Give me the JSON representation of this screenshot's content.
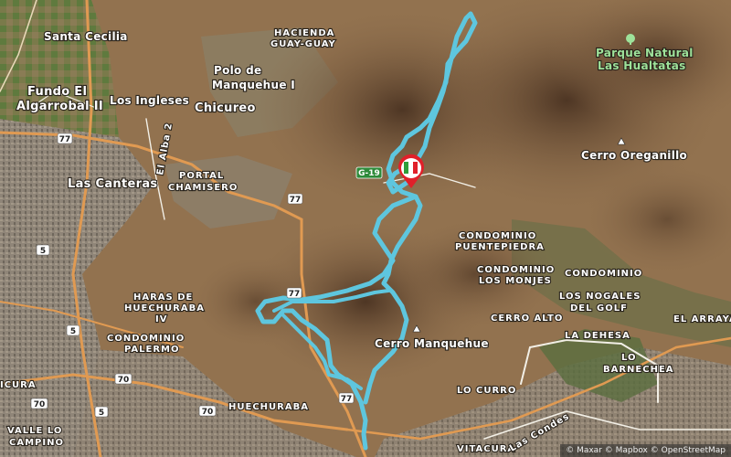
{
  "route_color": "#5ec6de",
  "labels": {
    "santa_cecilia": "Santa Cecilia",
    "fundo_el": "Fundo El",
    "algarrobal_ii": "Algarrobal II",
    "los_ingleses": "Los Ingleses",
    "chicureo": "Chicureo",
    "polo_de": "Polo de",
    "manquehue_i": "Manquehue I",
    "hacienda": "HACIENDA",
    "guay_guay": "GUAY-GUAY",
    "el_alba_2": "El Alba 2",
    "las_canteras": "Las Canteras",
    "portal": "PORTAL",
    "chamisero": "CHAMISERO",
    "parque_natural": "Parque Natural",
    "las_hualtatas": "Las Hualtatas",
    "cerro_oreganillo": "Cerro Oreganillo",
    "condominio_1": "CONDOMINIO",
    "puentepiedra": "PUENTEPIEDRA",
    "condominio_2": "CONDOMINIO",
    "los_monjes": "LOS MONJES",
    "condominio_3": "CONDOMINIO",
    "los_nogales": "LOS NOGALES",
    "del_golf": "DEL GOLF",
    "cerro_alto": "CERRO ALTO",
    "el_arrayan": "EL ARRAYÁN",
    "la_dehesa": "LA DEHESA",
    "lo_barnechea_1": "LO",
    "lo_barnechea_2": "BARNECHEA",
    "haras_de": "HARAS DE",
    "huechuraba_iv_1": "HUECHURABA",
    "huechuraba_iv_2": "IV",
    "condominio_4": "CONDOMINIO",
    "palermo": "PALERMO",
    "cerro_manquehue": "Cerro Manquehue",
    "lo_curro": "LO CURRO",
    "huechuraba": "HUECHURABA",
    "vitacura": "VITACURA",
    "las_condes": "Las Condes",
    "icura": "ICURA",
    "valle_lo": "VALLE LO",
    "campino": "CAMPINO"
  },
  "shields": {
    "r77a": "77",
    "r77b": "77",
    "r77c": "77",
    "r77d": "77",
    "r5a": "5",
    "r5b": "5",
    "r5c": "5",
    "r70a": "70",
    "r70b": "70",
    "r70c": "70",
    "g19": "G-19"
  },
  "attribution": "© Maxar © Mapbox © OpenStreetMap"
}
